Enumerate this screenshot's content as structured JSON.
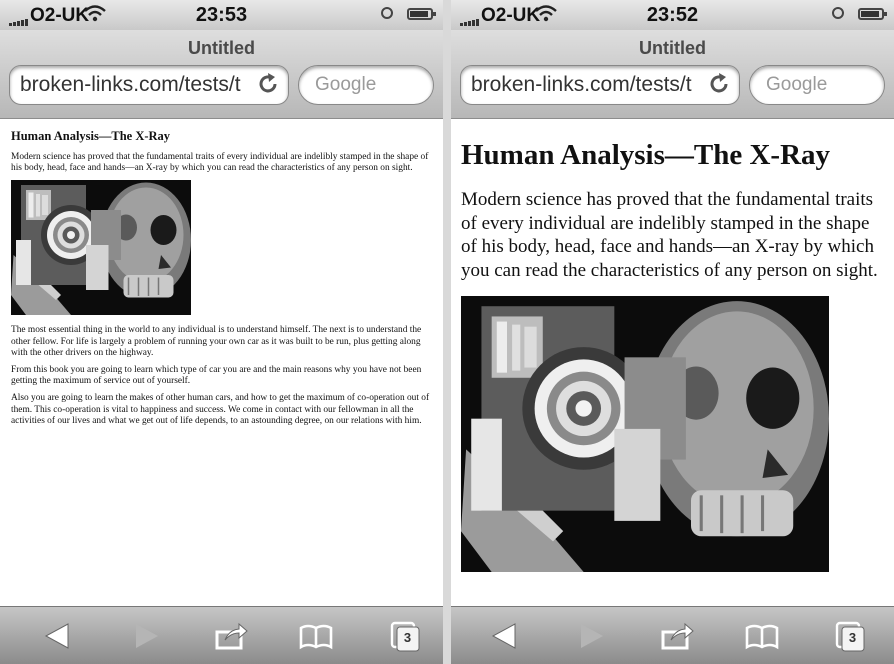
{
  "screens": [
    {
      "status": {
        "carrier": "O2-UK",
        "time": "23:53"
      },
      "browser": {
        "title": "Untitled",
        "url": "broken-links.com/tests/t",
        "search_placeholder": "Google",
        "tab_count": "3"
      },
      "article": {
        "heading": "Human Analysis—The X-Ray",
        "intro": "Modern science has proved that the fundamental traits of every individual are indelibly stamped in the shape of his body, head, face and hands—an X-ray by which you can read the characteristics of any person on sight.",
        "paragraphs": [
          "The most essential thing in the world to any individual is to understand himself. The next is to understand the other fellow. For life is largely a problem of running your own car as it was built to be run, plus getting along with the other drivers on the highway.",
          "From this book you are going to learn which type of car you are and the main reasons why you have not been getting the maximum of service out of yourself.",
          "Also you are going to learn the makes of other human cars, and how to get the maximum of co-operation out of them. This co-operation is vital to happiness and success. We come in contact with our fellowman in all the activities of our lives and what we get out of life depends, to an astounding degree, on our relations with him."
        ]
      }
    },
    {
      "status": {
        "carrier": "O2-UK",
        "time": "23:52"
      },
      "browser": {
        "title": "Untitled",
        "url": "broken-links.com/tests/t",
        "search_placeholder": "Google",
        "tab_count": "3"
      },
      "article": {
        "heading": "Human Analysis—The X-Ray",
        "intro": "Modern science has proved that the fundamental traits of every individual are indelibly stamped in the shape of his body, head, face and hands—an X-ray by which you can read the characteristics of any person on sight."
      }
    }
  ],
  "icons": {
    "back": "back-arrow-icon",
    "forward": "forward-arrow-icon",
    "share": "share-icon",
    "bookmarks": "bookmarks-icon",
    "tabs": "tabs-icon",
    "reload": "reload-icon",
    "wifi": "wifi-icon",
    "battery": "battery-icon",
    "alarm": "alarm-clock-icon",
    "signal": "signal-bars-icon"
  }
}
